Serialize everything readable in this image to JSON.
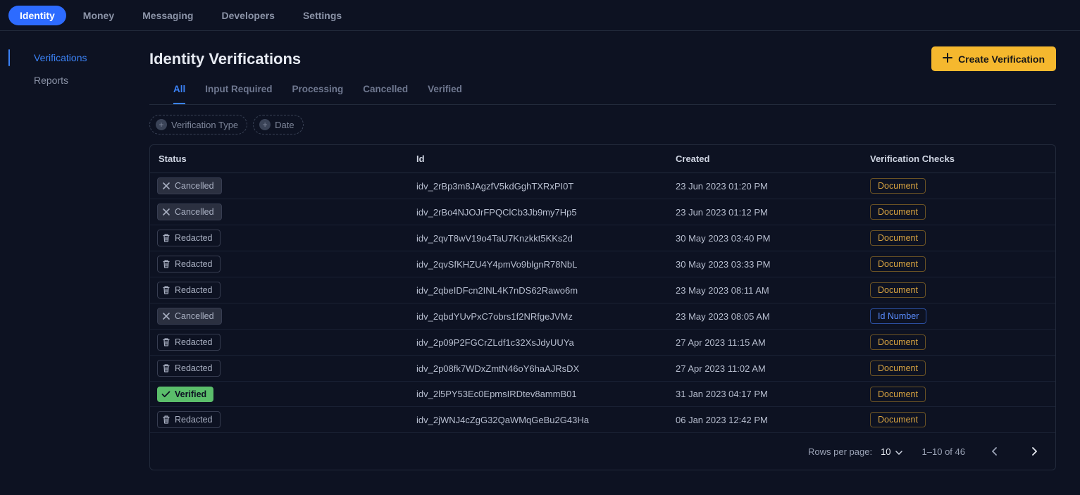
{
  "topNav": [
    {
      "label": "Identity",
      "active": true
    },
    {
      "label": "Money",
      "active": false
    },
    {
      "label": "Messaging",
      "active": false
    },
    {
      "label": "Developers",
      "active": false
    },
    {
      "label": "Settings",
      "active": false
    }
  ],
  "sidebar": [
    {
      "label": "Verifications",
      "active": true
    },
    {
      "label": "Reports",
      "active": false
    }
  ],
  "header": {
    "title": "Identity Verifications",
    "createButton": "Create Verification"
  },
  "subTabs": [
    {
      "label": "All",
      "active": true
    },
    {
      "label": "Input Required",
      "active": false
    },
    {
      "label": "Processing",
      "active": false
    },
    {
      "label": "Cancelled",
      "active": false
    },
    {
      "label": "Verified",
      "active": false
    }
  ],
  "filters": [
    {
      "label": "Verification Type"
    },
    {
      "label": "Date"
    }
  ],
  "table": {
    "columns": {
      "status": "Status",
      "id": "Id",
      "created": "Created",
      "checks": "Verification Checks"
    },
    "rows": [
      {
        "status": "Cancelled",
        "statusKind": "cancelled",
        "id": "idv_2rBp3m8JAgzfV5kdGghTXRxPI0T",
        "created": "23 Jun 2023 01:20 PM",
        "check": "Document",
        "checkKind": "document"
      },
      {
        "status": "Cancelled",
        "statusKind": "cancelled",
        "id": "idv_2rBo4NJOJrFPQClCb3Jb9my7Hp5",
        "created": "23 Jun 2023 01:12 PM",
        "check": "Document",
        "checkKind": "document"
      },
      {
        "status": "Redacted",
        "statusKind": "redacted",
        "id": "idv_2qvT8wV19o4TaU7Knzkkt5KKs2d",
        "created": "30 May 2023 03:40 PM",
        "check": "Document",
        "checkKind": "document"
      },
      {
        "status": "Redacted",
        "statusKind": "redacted",
        "id": "idv_2qvSfKHZU4Y4pmVo9blgnR78NbL",
        "created": "30 May 2023 03:33 PM",
        "check": "Document",
        "checkKind": "document"
      },
      {
        "status": "Redacted",
        "statusKind": "redacted",
        "id": "idv_2qbeIDFcn2INL4K7nDS62Rawo6m",
        "created": "23 May 2023 08:11 AM",
        "check": "Document",
        "checkKind": "document"
      },
      {
        "status": "Cancelled",
        "statusKind": "cancelled",
        "id": "idv_2qbdYUvPxC7obrs1f2NRfgeJVMz",
        "created": "23 May 2023 08:05 AM",
        "check": "Id Number",
        "checkKind": "idnumber"
      },
      {
        "status": "Redacted",
        "statusKind": "redacted",
        "id": "idv_2p09P2FGCrZLdf1c32XsJdyUUYa",
        "created": "27 Apr 2023 11:15 AM",
        "check": "Document",
        "checkKind": "document"
      },
      {
        "status": "Redacted",
        "statusKind": "redacted",
        "id": "idv_2p08fk7WDxZmtN46oY6haAJRsDX",
        "created": "27 Apr 2023 11:02 AM",
        "check": "Document",
        "checkKind": "document"
      },
      {
        "status": "Verified",
        "statusKind": "verified",
        "id": "idv_2l5PY53Ec0EpmsIRDtev8ammB01",
        "created": "31 Jan 2023 04:17 PM",
        "check": "Document",
        "checkKind": "document"
      },
      {
        "status": "Redacted",
        "statusKind": "redacted",
        "id": "idv_2jWNJ4cZgG32QaWMqGeBu2G43Ha",
        "created": "06 Jan 2023 12:42 PM",
        "check": "Document",
        "checkKind": "document"
      }
    ]
  },
  "pagination": {
    "rowsPerPageLabel": "Rows per page:",
    "rowsPerPageValue": "10",
    "rangeLabel": "1–10 of 46",
    "prevEnabled": false,
    "nextEnabled": true
  }
}
